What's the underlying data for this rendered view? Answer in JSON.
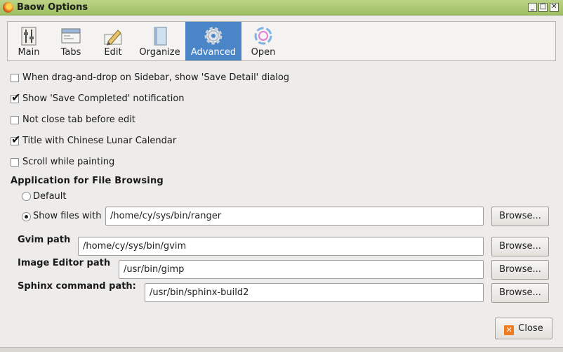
{
  "window": {
    "title": "Baow Options"
  },
  "tabs": [
    {
      "label": "Main",
      "icon": "sliders-icon"
    },
    {
      "label": "Tabs",
      "icon": "tabs-window-icon"
    },
    {
      "label": "Edit",
      "icon": "pencil-edit-icon"
    },
    {
      "label": "Organize",
      "icon": "book-icon"
    },
    {
      "label": "Advanced",
      "icon": "gear-icon",
      "active": true
    },
    {
      "label": "Open",
      "icon": "ring-open-icon"
    }
  ],
  "options": [
    {
      "label": "When drag-and-drop on Sidebar, show 'Save Detail' dialog",
      "checked": false
    },
    {
      "label": "Show 'Save Completed' notification",
      "checked": true
    },
    {
      "label": "Not close tab before edit",
      "checked": false
    },
    {
      "label": "Title with Chinese Lunar Calendar",
      "checked": true
    },
    {
      "label": "Scroll while painting",
      "checked": false
    }
  ],
  "file_browsing": {
    "title": "Application for File Browsing",
    "default_label": "Default",
    "show_files_label": "Show files with",
    "selected": "show_files",
    "show_files_value": "/home/cy/sys/bin/ranger",
    "browse_label": "Browse..."
  },
  "paths": {
    "gvim_label": "Gvim path",
    "gvim_value": "/home/cy/sys/bin/gvim",
    "image_editor_label": "Image Editor path",
    "image_editor_value": "/usr/bin/gimp",
    "sphinx_label": "Sphinx command path:",
    "sphinx_value": "/usr/bin/sphinx-build2",
    "browse_label": "Browse..."
  },
  "footer": {
    "close_label": "Close"
  },
  "colors": {
    "titlebar": "#a9c86d",
    "active_tab": "#4a86c7",
    "close_icon": "#f07a1e"
  }
}
